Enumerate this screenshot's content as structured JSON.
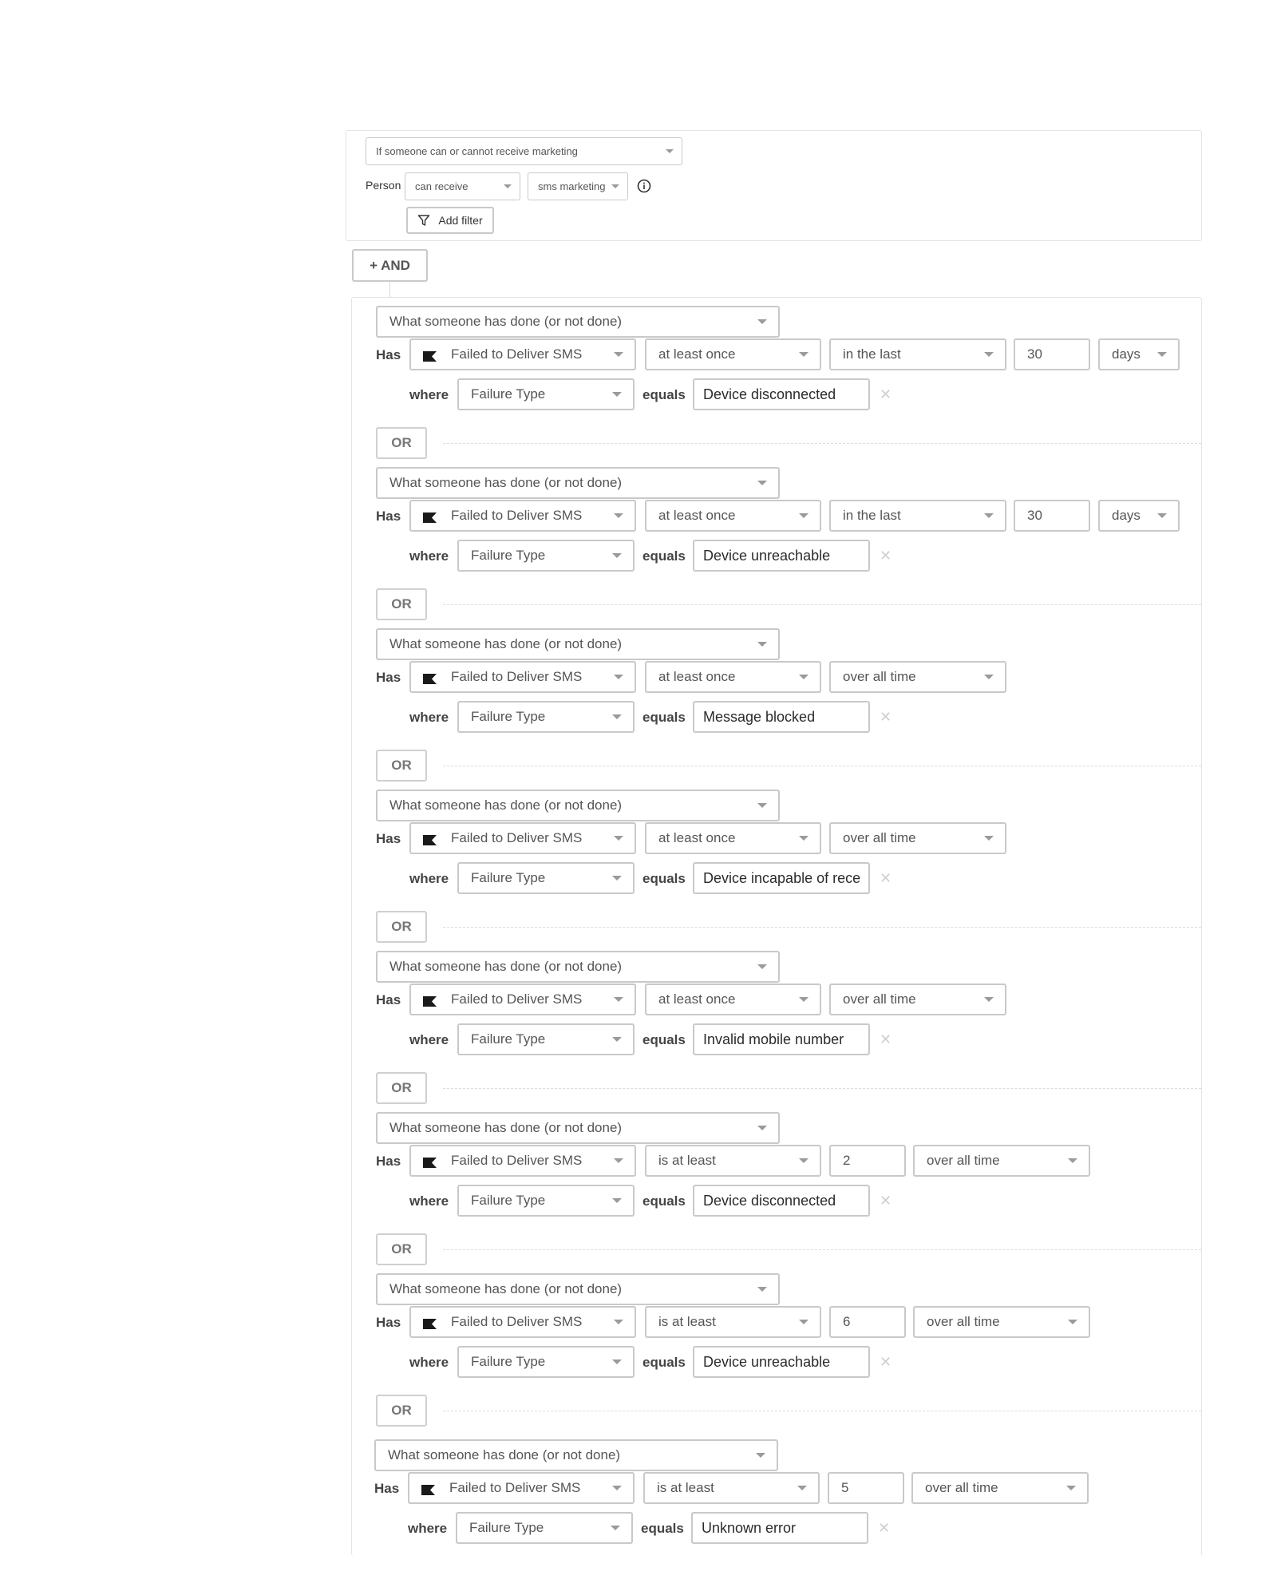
{
  "top_condition": {
    "type_label": "If someone can or cannot receive marketing",
    "person_label": "Person",
    "receive_value": "can receive",
    "channel_value": "sms marketing",
    "info_icon": "info-circle-icon",
    "add_filter_label": "Add filter",
    "filter_icon": "funnel-icon"
  },
  "and_button_label": "+ AND",
  "or_label": "OR",
  "labels": {
    "has": "Has",
    "where": "where",
    "equals": "equals"
  },
  "metric_icon": "flag-icon",
  "conditions": [
    {
      "type": "What someone has done (or not done)",
      "metric": "Failed to Deliver SMS",
      "frequency": "at least once",
      "timeframe": "in the last",
      "count": "30",
      "unit": "days",
      "property": "Failure Type",
      "value": "Device disconnected"
    },
    {
      "type": "What someone has done (or not done)",
      "metric": "Failed to Deliver SMS",
      "frequency": "at least once",
      "timeframe": "in the last",
      "count": "30",
      "unit": "days",
      "property": "Failure Type",
      "value": "Device unreachable"
    },
    {
      "type": "What someone has done (or not done)",
      "metric": "Failed to Deliver SMS",
      "frequency": "at least once",
      "timeframe": "over all time",
      "property": "Failure Type",
      "value": "Message blocked"
    },
    {
      "type": "What someone has done (or not done)",
      "metric": "Failed to Deliver SMS",
      "frequency": "at least once",
      "timeframe": "over all time",
      "property": "Failure Type",
      "value": "Device incapable of rece"
    },
    {
      "type": "What someone has done (or not done)",
      "metric": "Failed to Deliver SMS",
      "frequency": "at least once",
      "timeframe": "over all time",
      "property": "Failure Type",
      "value": "Invalid mobile number"
    },
    {
      "type": "What someone has done (or not done)",
      "metric": "Failed to Deliver SMS",
      "frequency": "is at least",
      "count": "2",
      "timeframe": "over all time",
      "property": "Failure Type",
      "value": "Device disconnected"
    },
    {
      "type": "What someone has done (or not done)",
      "metric": "Failed to Deliver SMS",
      "frequency": "is at least",
      "count": "6",
      "timeframe": "over all time",
      "property": "Failure Type",
      "value": "Device unreachable"
    },
    {
      "type": "What someone has done (or not done)",
      "metric": "Failed to Deliver SMS",
      "frequency": "is at least",
      "count": "5",
      "timeframe": "over all time",
      "property": "Failure Type",
      "value": "Unknown error"
    }
  ]
}
